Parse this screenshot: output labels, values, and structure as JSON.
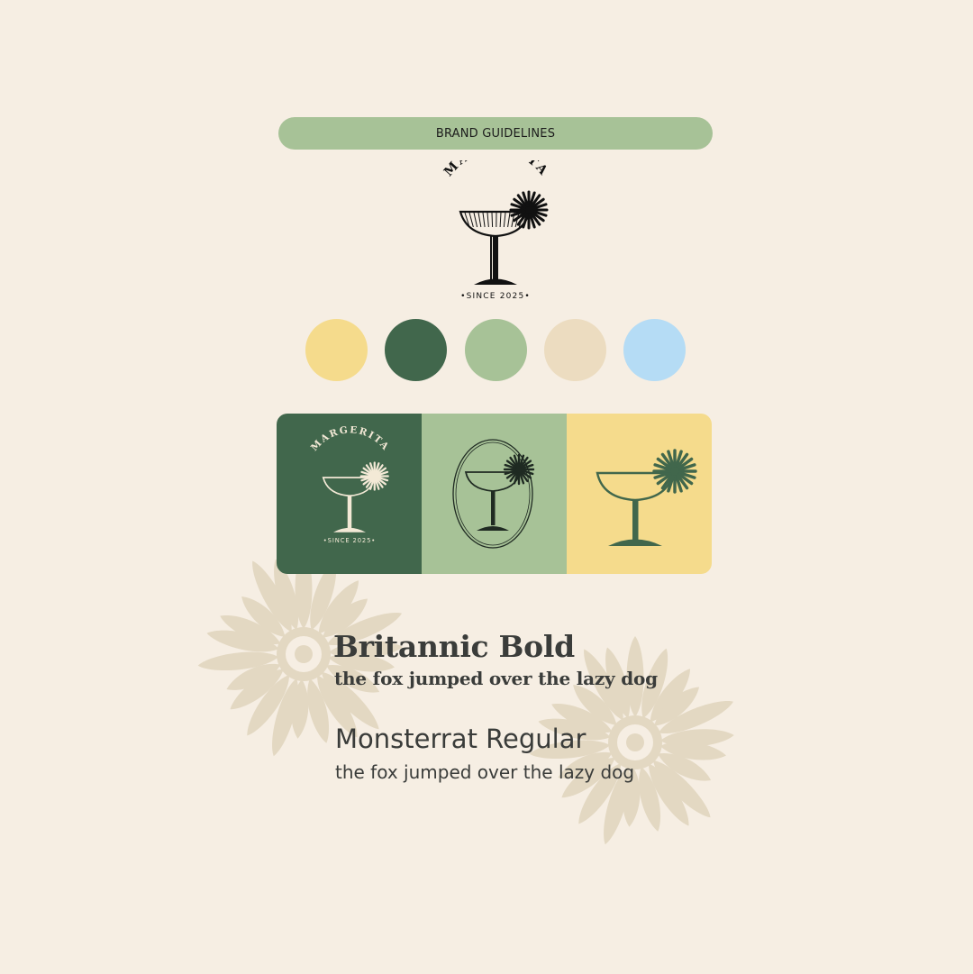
{
  "header": {
    "label": "BRAND GUIDELINES"
  },
  "brand": {
    "name": "MARGERITA",
    "tagline": "•SINCE 2025•"
  },
  "palette": [
    {
      "name": "yellow",
      "hex": "#f5db8c"
    },
    {
      "name": "dark-green",
      "hex": "#41674c"
    },
    {
      "name": "sage",
      "hex": "#a7c297"
    },
    {
      "name": "sand",
      "hex": "#ecdcc0"
    },
    {
      "name": "sky-blue",
      "hex": "#b5dcf5"
    }
  ],
  "logo_panels": [
    {
      "variant": "full-logo-light",
      "background": "#41674c",
      "ink": "#f3e9d6",
      "name": "MARGERITA",
      "tagline": "•SINCE 2025•"
    },
    {
      "variant": "oval-emblem",
      "background": "#a7c297",
      "ink": "#1f2a22"
    },
    {
      "variant": "glass-icon",
      "background": "#f5db8c",
      "ink": "#41674c"
    }
  ],
  "typography": [
    {
      "font_name": "Britannic Bold",
      "sample": "the fox jumped over the lazy dog"
    },
    {
      "font_name": "Monsterrat Regular",
      "sample": "the fox jumped over the lazy dog"
    }
  ],
  "colors": {
    "background": "#f6eee3",
    "flower": "#e3d8c2",
    "text": "#3a3c3a"
  },
  "icons": [
    "coupe-glass-logo-icon",
    "daisy-flower-icon"
  ]
}
